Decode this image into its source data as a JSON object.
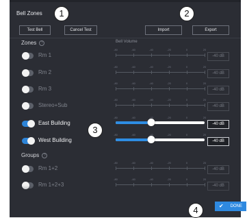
{
  "header": {
    "title": "Bell Zones"
  },
  "toolbar": {
    "test_bell": "Test Bell",
    "cancel_test": "Cancel Test",
    "import": "Import",
    "export": "Export"
  },
  "zones_section": {
    "label": "Zones",
    "help_icon": "?",
    "bell_volume_label": "Bell Volume"
  },
  "groups_section": {
    "label": "Groups",
    "help_icon": "?"
  },
  "scale_ticks": [
    "-80",
    "-60",
    "-40",
    "-20",
    "0",
    "20"
  ],
  "zones": [
    {
      "name": "Rm 1",
      "enabled": false,
      "value": "-40 dB",
      "level_fraction": 0.4
    },
    {
      "name": "Rm 2",
      "enabled": false,
      "value": "-40 dB",
      "level_fraction": 0.4
    },
    {
      "name": "Rm 3",
      "enabled": false,
      "value": "-40 dB",
      "level_fraction": 0.4
    },
    {
      "name": "Stereo+Sub",
      "enabled": false,
      "value": "-40 dB",
      "level_fraction": 0.4
    },
    {
      "name": "East Building",
      "enabled": true,
      "value": "-40 dB",
      "level_fraction": 0.4
    },
    {
      "name": "West Building",
      "enabled": true,
      "value": "-40 dB",
      "level_fraction": 0.4
    }
  ],
  "groups": [
    {
      "name": "Rm 1+2",
      "enabled": false,
      "value": "-40 dB",
      "level_fraction": 0.4
    },
    {
      "name": "Rm 1+2+3",
      "enabled": false,
      "value": "-40 dB",
      "level_fraction": 0.4
    }
  ],
  "footer": {
    "done_label": "DONE",
    "done_icon": "✔"
  },
  "callouts": [
    "1",
    "2",
    "3",
    "4"
  ],
  "colors": {
    "panel_bg": "#2b2d34",
    "accent": "#2e89e0"
  }
}
